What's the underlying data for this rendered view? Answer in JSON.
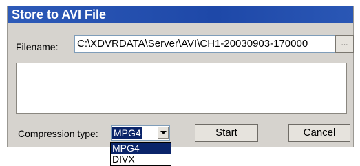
{
  "dialog": {
    "title": "Store to AVI File",
    "filename_label": "Filename:",
    "filename_value": "C:\\XDVRDATA\\Server\\AVI\\CH1-20030903-170000",
    "browse_label": "...",
    "compression_label": "Compression type:",
    "compression_selected": "MPG4",
    "start_label": "Start",
    "cancel_label": "Cancel"
  },
  "dropdown": {
    "options": [
      "MPG4",
      "DIVX"
    ]
  },
  "colors": {
    "title_bar": "#1e48a8",
    "selection": "#0a246a",
    "dialog_bg": "#d6d3ce"
  }
}
